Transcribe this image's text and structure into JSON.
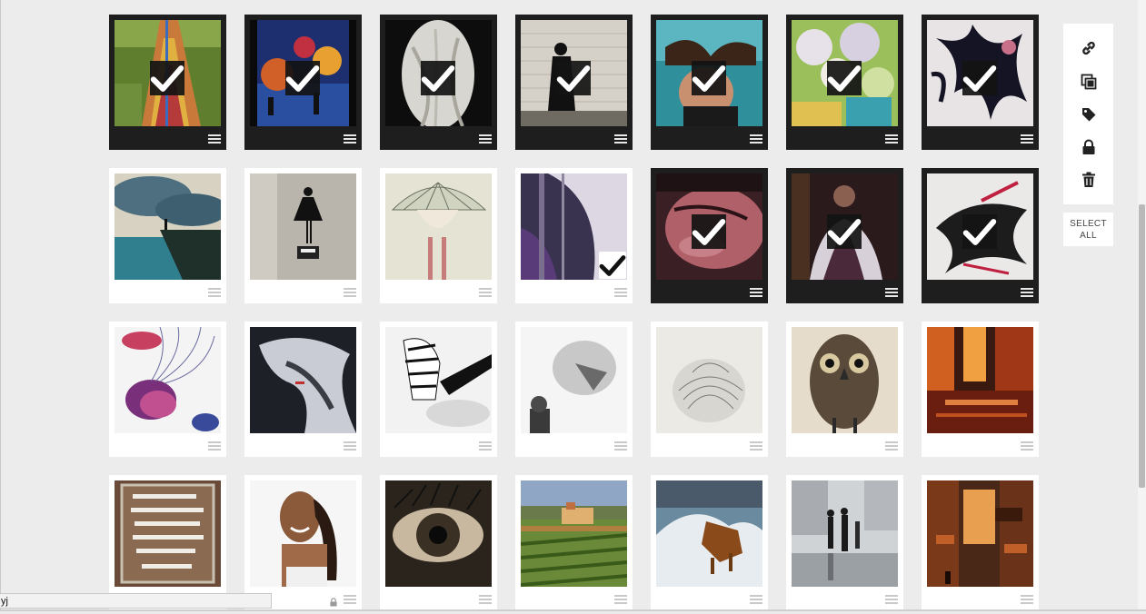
{
  "toolbar": {
    "tools": [
      {
        "name": "link-icon"
      },
      {
        "name": "duplicate-icon"
      },
      {
        "name": "tag-icon"
      },
      {
        "name": "lock-icon"
      },
      {
        "name": "trash-icon"
      }
    ],
    "select_all_label_line1": "SELECT",
    "select_all_label_line2": "ALL"
  },
  "status_bar": {
    "url_text": "yj"
  },
  "colors": {
    "selected_tile": "#1e1e1e",
    "tile": "#ffffff",
    "background": "#ececec"
  },
  "tiles": [
    {
      "id": "staircase-mosaic",
      "selected": true
    },
    {
      "id": "rainy-street-painting",
      "selected": true
    },
    {
      "id": "marble-statue",
      "selected": true
    },
    {
      "id": "banksy-maid",
      "selected": true
    },
    {
      "id": "underwater-woman",
      "selected": true
    },
    {
      "id": "flower-painting",
      "selected": true
    },
    {
      "id": "ink-splash",
      "selected": true
    },
    {
      "id": "cliff-edge",
      "selected": false
    },
    {
      "id": "banksy-ballerina",
      "selected": false
    },
    {
      "id": "umbrella-girl",
      "selected": false
    },
    {
      "id": "abstract-face",
      "selected": false,
      "hover_check": true
    },
    {
      "id": "sleeping-face",
      "selected": true
    },
    {
      "id": "dark-drapery",
      "selected": true
    },
    {
      "id": "ink-woman",
      "selected": true
    },
    {
      "id": "jellyfish",
      "selected": false
    },
    {
      "id": "smoke-portrait",
      "selected": false
    },
    {
      "id": "zebra-drawing",
      "selected": false
    },
    {
      "id": "lion-cat",
      "selected": false
    },
    {
      "id": "hair-sketch",
      "selected": false
    },
    {
      "id": "owl-drawing",
      "selected": false
    },
    {
      "id": "city-rain-orange",
      "selected": false
    },
    {
      "id": "window-quote",
      "selected": false
    },
    {
      "id": "smiling-woman",
      "selected": false,
      "locked": true
    },
    {
      "id": "eye-closeup",
      "selected": false
    },
    {
      "id": "tuscany-vineyard",
      "selected": false
    },
    {
      "id": "horse-waves",
      "selected": false
    },
    {
      "id": "rainy-pedestrians",
      "selected": false
    },
    {
      "id": "orange-alley",
      "selected": false
    }
  ]
}
